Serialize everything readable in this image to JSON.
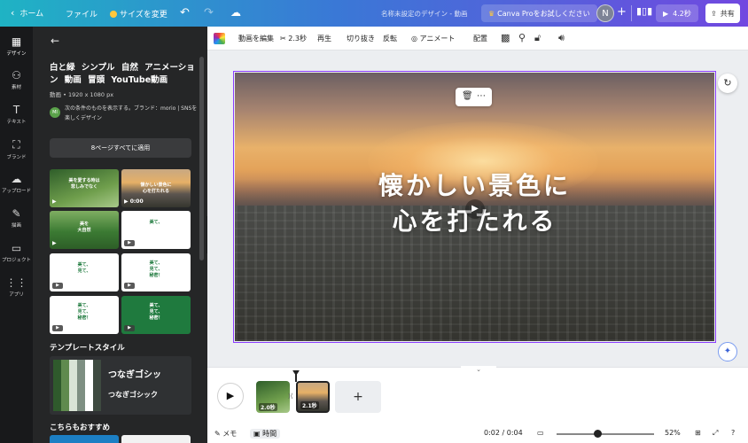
{
  "topbar": {
    "home": "ホーム",
    "file": "ファイル",
    "resize": "サイズを変更",
    "title": "名称未設定のデザイン - 動画",
    "pro_cta": "Canva Proをお試しください",
    "avatar_initial": "N",
    "play_duration": "4.2秒",
    "share": "共有"
  },
  "rail": [
    {
      "icon": "design-icon",
      "label": "デザイン"
    },
    {
      "icon": "elements-icon",
      "label": "素材"
    },
    {
      "icon": "text-icon",
      "label": "テキスト"
    },
    {
      "icon": "brand-icon",
      "label": "ブランド"
    },
    {
      "icon": "uploads-icon",
      "label": "アップロード"
    },
    {
      "icon": "draw-icon",
      "label": "描画"
    },
    {
      "icon": "projects-icon",
      "label": "プロジェクト"
    },
    {
      "icon": "apps-icon",
      "label": "アプリ"
    }
  ],
  "panel": {
    "tags": "白と緑 シンプル 自然 アニメーション 動画 冒頭 YouTube動画",
    "meta": "動画 • 1920 x 1080 px",
    "creator_initials": "MI",
    "creator_text": "次の条件のものを表示する。ブランド：morio | SNSを楽しくデザイン",
    "apply_button": "8ページすべてに適用",
    "thumbs": [
      {
        "caption": "美を愛する時は\n悲しみでなく",
        "badge": "",
        "colors": [
          "#3d6a3a",
          "#7fae62"
        ]
      },
      {
        "caption": "懐かしい景色に\n心を打たれる",
        "badge": "0:00",
        "colors": [
          "#8a6a4e",
          "#2f3234"
        ]
      },
      {
        "caption": "美を\n大自然",
        "badge": "",
        "colors": [
          "#3b7a33",
          "#8dbb5a"
        ]
      },
      {
        "caption": "美て、",
        "badge": "",
        "colors": [
          "#ffffff",
          "#ffffff"
        ]
      },
      {
        "caption": "美て、\n見て、",
        "badge": "",
        "colors": [
          "#ffffff",
          "#ffffff"
        ]
      },
      {
        "caption": "美て、\n見て、\n秘密！",
        "badge": "",
        "colors": [
          "#ffffff",
          "#ffffff"
        ]
      },
      {
        "caption": "美て、\n見て、\n秘密！",
        "badge": "",
        "colors": [
          "#ffffff",
          "#ffffff"
        ]
      },
      {
        "caption": "美て、\n見て、\n秘密！",
        "badge": "",
        "colors": [
          "#1f7a3e",
          "#1f7a3e"
        ]
      }
    ],
    "style_section": "テンプレートスタイル",
    "style_text_1": "つなぎゴシッ",
    "style_text_2": "つなぎゴシック",
    "recommend_section": "こちらもおすすめ"
  },
  "context_toolbar": {
    "edit_video": "動画を編集",
    "duration": "2.3秒",
    "playback": "再生",
    "crop": "切り抜き",
    "flip": "反転",
    "animate": "アニメート",
    "position": "配置"
  },
  "canvas": {
    "headline_line1": "懐かしい景色に",
    "headline_line2": "心を打たれる"
  },
  "timeline": {
    "clips": [
      {
        "duration": "2.0秒",
        "selected": false
      },
      {
        "duration": "2.1秒",
        "selected": true
      }
    ]
  },
  "statusbar": {
    "notes": "メモ",
    "timing": "時間",
    "time": "0:02 / 0:04",
    "zoom": "52%"
  },
  "colors": {
    "accent": "#8b3dff",
    "panel_bg": "#252627",
    "rail_bg": "#18191b"
  }
}
